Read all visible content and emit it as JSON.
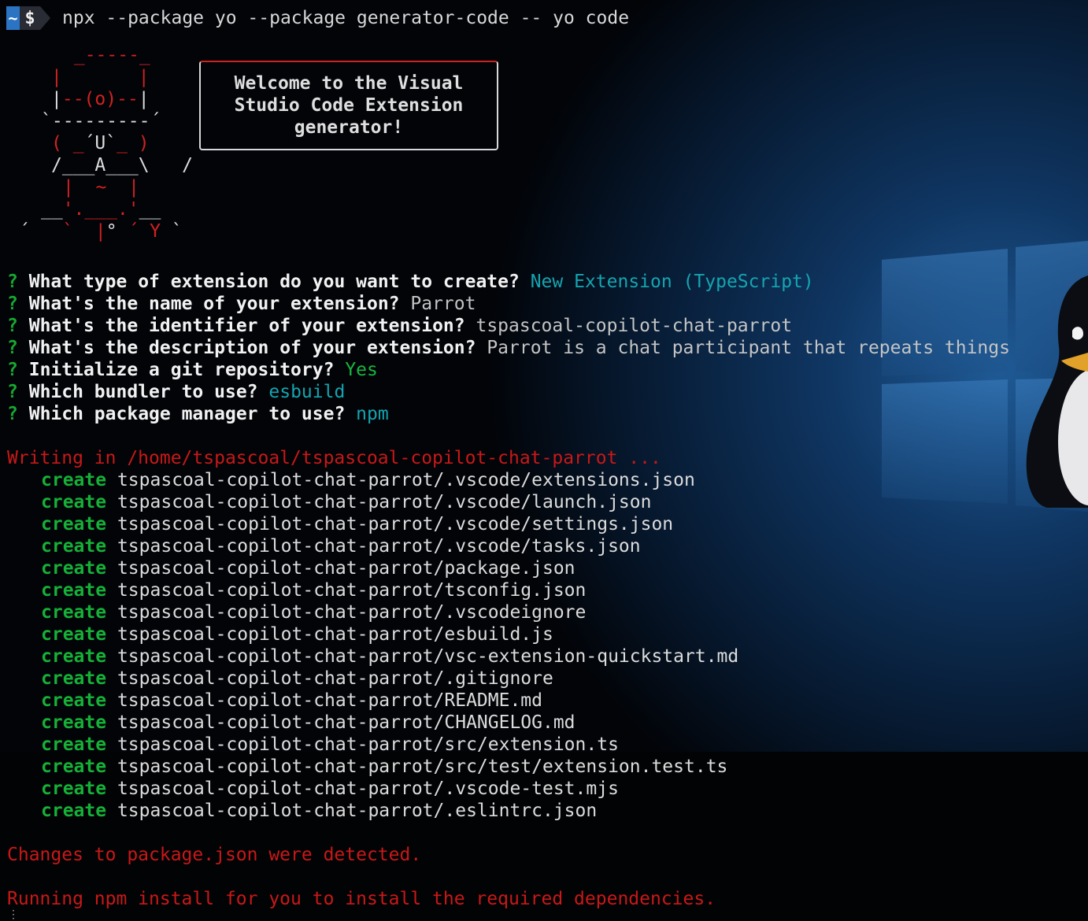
{
  "prompt": {
    "home_symbol": "~",
    "dollar_symbol": "$",
    "command": "npx --package yo --package generator-code -- yo code"
  },
  "welcome": {
    "lines": [
      "Welcome to the Visual",
      "Studio Code Extension",
      "generator!"
    ]
  },
  "questions": [
    {
      "mark": "?",
      "text": "What type of extension do you want to create?",
      "answer": "New Extension (TypeScript)",
      "answer_style": "cyan"
    },
    {
      "mark": "?",
      "text": "What's the name of your extension?",
      "answer": "Parrot",
      "answer_style": "gray"
    },
    {
      "mark": "?",
      "text": "What's the identifier of your extension?",
      "answer": "tspascoal-copilot-chat-parrot",
      "answer_style": "gray"
    },
    {
      "mark": "?",
      "text": "What's the description of your extension?",
      "answer": "Parrot is a chat participant that repeats things",
      "answer_style": "gray"
    },
    {
      "mark": "?",
      "text": "Initialize a git repository?",
      "answer": "Yes",
      "answer_style": "green"
    },
    {
      "mark": "?",
      "text": "Which bundler to use?",
      "answer": "esbuild",
      "answer_style": "cyan"
    },
    {
      "mark": "?",
      "text": "Which package manager to use?",
      "answer": "npm",
      "answer_style": "cyan"
    }
  ],
  "writing_line": "Writing in /home/tspascoal/tspascoal-copilot-chat-parrot ...",
  "create_keyword": "create",
  "created_files": [
    "tspascoal-copilot-chat-parrot/.vscode/extensions.json",
    "tspascoal-copilot-chat-parrot/.vscode/launch.json",
    "tspascoal-copilot-chat-parrot/.vscode/settings.json",
    "tspascoal-copilot-chat-parrot/.vscode/tasks.json",
    "tspascoal-copilot-chat-parrot/package.json",
    "tspascoal-copilot-chat-parrot/tsconfig.json",
    "tspascoal-copilot-chat-parrot/.vscodeignore",
    "tspascoal-copilot-chat-parrot/esbuild.js",
    "tspascoal-copilot-chat-parrot/vsc-extension-quickstart.md",
    "tspascoal-copilot-chat-parrot/.gitignore",
    "tspascoal-copilot-chat-parrot/README.md",
    "tspascoal-copilot-chat-parrot/CHANGELOG.md",
    "tspascoal-copilot-chat-parrot/src/extension.ts",
    "tspascoal-copilot-chat-parrot/src/test/extension.test.ts",
    "tspascoal-copilot-chat-parrot/.vscode-test.mjs",
    "tspascoal-copilot-chat-parrot/.eslintrc.json"
  ],
  "changes_line": "Changes to package.json were detected.",
  "running_line": "Running npm install for you to install the required dependencies.",
  "colors": {
    "background": "#020305",
    "question_mark": "#17a832",
    "answer_cyan": "#14a5b0",
    "answer_green": "#17b640",
    "error_red": "#c91818",
    "create_green": "#16b038"
  }
}
